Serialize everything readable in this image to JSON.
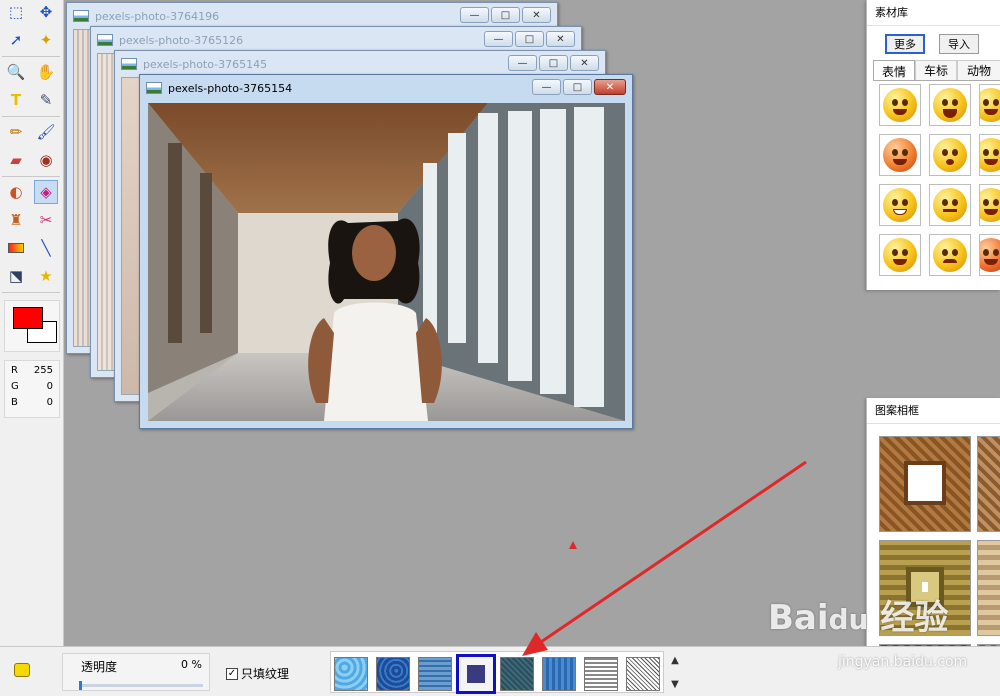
{
  "windows": [
    {
      "title": "pexels-photo-3764196"
    },
    {
      "title": "pexels-photo-3765126"
    },
    {
      "title": "pexels-photo-3765145"
    },
    {
      "title": "pexels-photo-3765154"
    }
  ],
  "window_buttons": {
    "minimize": "—",
    "maximize": "□",
    "close": "✕"
  },
  "toolbar": {
    "tools": [
      "rect-select",
      "move",
      "lasso",
      "magic-wand",
      "zoom",
      "hand",
      "text",
      "eyedropper",
      "pencil",
      "brush",
      "eraser",
      "red-eye",
      "color-replace",
      "fill",
      "clone-stamp",
      "heal",
      "gradient",
      "line",
      "transform",
      "shape"
    ],
    "foreground_color": "#ff0000",
    "background_color": "#ffffff",
    "rgb": [
      {
        "label": "R",
        "value": "255"
      },
      {
        "label": "G",
        "value": "0"
      },
      {
        "label": "B",
        "value": "0"
      }
    ]
  },
  "library": {
    "title": "素材库",
    "more_button": "更多",
    "import_button": "导入",
    "tabs": [
      "表情",
      "车标",
      "动物"
    ]
  },
  "frames_panel": {
    "title": "图案相框"
  },
  "bottom": {
    "opacity_label": "透明度",
    "opacity_value": "0 %",
    "opacity_level": 0,
    "texture_only_label": "只填纹理",
    "texture_only_checked": "✓",
    "selected_texture_index": 3
  },
  "watermark": {
    "logo": "Bai du 经验",
    "url": "jingyan.baidu.com"
  }
}
